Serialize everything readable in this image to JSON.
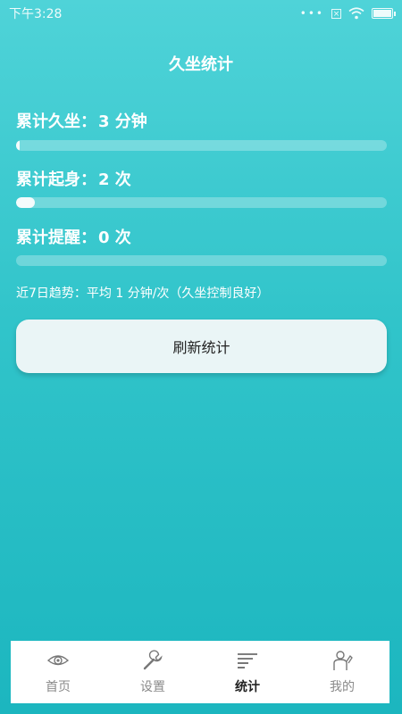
{
  "status_bar": {
    "time": "下午3:28",
    "dots": "•••",
    "x_box": "×"
  },
  "header": {
    "title": "久坐统计"
  },
  "stats": [
    {
      "label": "累计久坐：",
      "value": "3 分钟",
      "progress": 0.01
    },
    {
      "label": "累计起身：",
      "value": "2 次",
      "progress": 0.05
    },
    {
      "label": "累计提醒：",
      "value": "0 次",
      "progress": 0.0
    }
  ],
  "trend": {
    "text": "近7日趋势：平均 1 分钟/次（久坐控制良好）"
  },
  "refresh_button": {
    "label": "刷新统计"
  },
  "tabs": [
    {
      "label": "首页",
      "icon": "eye-icon",
      "active": false
    },
    {
      "label": "设置",
      "icon": "wrench-icon",
      "active": false
    },
    {
      "label": "统计",
      "icon": "stats-lines-icon",
      "active": true
    },
    {
      "label": "我的",
      "icon": "person-icon",
      "active": false
    }
  ]
}
